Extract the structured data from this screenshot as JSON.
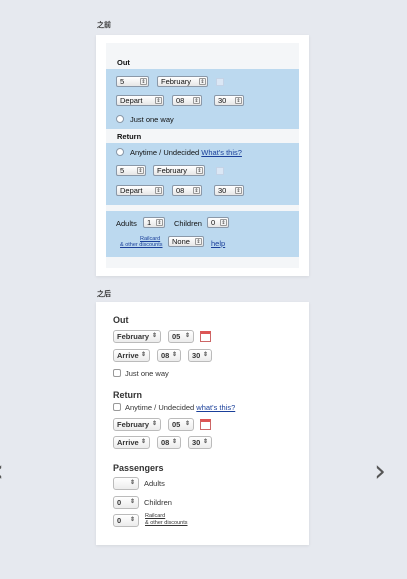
{
  "before": {
    "caption": "之前",
    "out_heading": "Out",
    "out_day": "5",
    "out_month": "February",
    "out_time_mode": "Depart",
    "out_hour": "08",
    "out_minute": "30",
    "just_one_way": "Just one way",
    "return_heading": "Return",
    "anytime": "Anytime / Undecided",
    "whats_this": "What's this?",
    "ret_day": "5",
    "ret_month": "February",
    "ret_time_mode": "Depart",
    "ret_hour": "08",
    "ret_minute": "30",
    "adults_label": "Adults",
    "adults_value": "1",
    "children_label": "Children",
    "children_value": "0",
    "railcard_line1": "Railcard",
    "railcard_line2": "& other discounts",
    "railcard_value": "None",
    "help": "help"
  },
  "after": {
    "caption": "之后",
    "out_heading": "Out",
    "out_month": "February",
    "out_day": "05",
    "out_time_mode": "Arrive",
    "out_hour": "08",
    "out_minute": "30",
    "just_one_way": "Just one way",
    "return_heading": "Return",
    "anytime": "Anytime / Undecided",
    "whats_this": "what's this?",
    "ret_month": "February",
    "ret_day": "05",
    "ret_time_mode": "Arrive",
    "ret_hour": "08",
    "ret_minute": "30",
    "passengers_heading": "Passengers",
    "adults_label": "Adults",
    "children_value": "0",
    "children_label": "Children",
    "railcard_value": "0",
    "railcard_line1": "Railcard",
    "railcard_line2": "& other discounts"
  },
  "nav": {
    "prev": "‹",
    "next": "›"
  }
}
